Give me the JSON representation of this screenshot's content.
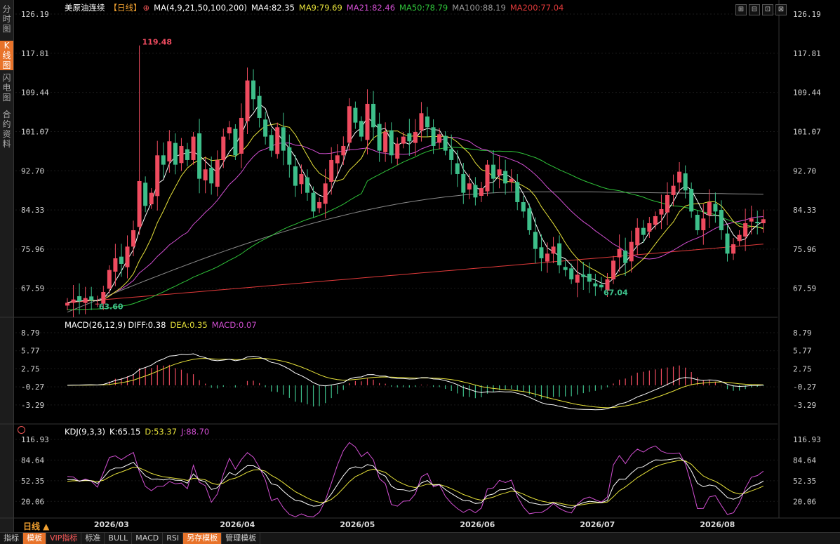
{
  "sidebar": {
    "tabs": [
      {
        "label": "分时图",
        "active": false
      },
      {
        "label": "K线图",
        "active": true
      },
      {
        "label": "闪电图",
        "active": false
      },
      {
        "label": "合约资料",
        "active": false
      }
    ]
  },
  "header": {
    "instrument": "美原油连续",
    "period_tag": "【日线】",
    "ma_params": "MA(4,9,21,50,100,200)",
    "ma4": "MA4:82.35",
    "ma9": "MA9:79.69",
    "ma21": "MA21:82.46",
    "ma50": "MA50:78.79",
    "ma100": "MA100:88.19",
    "ma200": "MA200:77.04"
  },
  "window_buttons": [
    "⊞",
    "⊟",
    "⊡",
    "⊠"
  ],
  "colors": {
    "up": "#ef4b5f",
    "down": "#3dbf8a",
    "ma4": "#ffffff",
    "ma9": "#e7e23a",
    "ma21": "#d24fd2",
    "ma50": "#2fc43a",
    "ma100": "#8a8a8a",
    "ma200": "#e23a3a",
    "macd_diff": "#ffffff",
    "macd_dea": "#e7e23a",
    "kdj_k": "#ffffff",
    "kdj_d": "#e7e23a",
    "kdj_j": "#d24fd2",
    "accent": "#e8732a"
  },
  "price_panel": {
    "ticks": [
      "126.19",
      "117.81",
      "109.44",
      "101.07",
      "92.70",
      "84.33",
      "75.96",
      "67.59"
    ],
    "high_label": "119.48",
    "low_label_1": "63.60",
    "low_label_2": "67.04"
  },
  "macd_panel": {
    "title": "MACD(26,12,9)",
    "diff": "DIFF:0.38",
    "dea": "DEA:0.35",
    "macd": "MACD:0.07",
    "ticks": [
      "8.79",
      "5.77",
      "2.75",
      "-0.27",
      "-3.29"
    ]
  },
  "kdj_panel": {
    "title": "KDJ(9,3,3)",
    "k": "K:65.15",
    "d": "D:53.37",
    "j": "J:88.70",
    "ticks": [
      "116.93",
      "84.64",
      "52.35",
      "20.06"
    ]
  },
  "dates": [
    "2026/03",
    "2026/04",
    "2026/05",
    "2026/06",
    "2026/07",
    "2026/08"
  ],
  "period_label": "日线 ▲",
  "bottom_tabs": [
    {
      "label": "指标",
      "style": "normal"
    },
    {
      "label": "模板",
      "style": "orange"
    },
    {
      "label": "VIP指标",
      "style": "red"
    },
    {
      "label": "标准",
      "style": "normal"
    },
    {
      "label": "BULL",
      "style": "normal"
    },
    {
      "label": "MACD",
      "style": "normal"
    },
    {
      "label": "RSI",
      "style": "normal"
    },
    {
      "label": "另存模板",
      "style": "orange"
    },
    {
      "label": "管理模板",
      "style": "normal"
    }
  ],
  "chart_data": {
    "type": "candlestick",
    "closes": [
      64.5,
      65.2,
      64.8,
      65.5,
      65.0,
      64.3,
      66.8,
      71.5,
      74.0,
      72.8,
      76.5,
      80.0,
      90.5,
      85.2,
      88.0,
      96.0,
      94.0,
      99.0,
      94.0,
      98.0,
      95.0,
      100.0,
      91.0,
      93.0,
      90.0,
      95.0,
      100.0,
      102.0,
      96.0,
      104.0,
      112.0,
      108.0,
      104.0,
      100.0,
      97.0,
      102.0,
      97.0,
      94.0,
      89.5,
      92.0,
      88.0,
      84.0,
      86.0,
      90.0,
      95.0,
      96.0,
      98.0,
      106.5,
      103.0,
      100.0,
      107.0,
      102.0,
      97.0,
      101.0,
      96.0,
      98.5,
      100.0,
      99.0,
      101.0,
      105.0,
      102.0,
      98.0,
      100.5,
      97.0,
      95.0,
      92.0,
      88.0,
      90.0,
      87.0,
      89.0,
      94.0,
      91.0,
      93.0,
      90.0,
      91.0,
      86.0,
      84.0,
      80.0,
      76.0,
      74.0,
      75.0,
      76.5,
      72.5,
      71.5,
      69.5,
      70.5,
      70.0,
      69.0,
      68.0,
      67.8,
      69.5,
      73.5,
      76.0,
      73.0,
      77.5,
      80.5,
      79.0,
      81.5,
      83.0,
      84.5,
      87.5,
      89.5,
      92.5,
      88.5,
      84.0,
      80.0,
      82.5,
      86.0,
      84.0,
      80.0,
      75.0,
      77.0,
      79.0,
      81.5,
      82.5,
      81.5,
      82.35
    ],
    "ma_last": {
      "MA4": 82.35,
      "MA9": 79.69,
      "MA21": 82.46,
      "MA50": 78.79,
      "MA100": 88.19,
      "MA200": 77.04
    },
    "macd_last": {
      "DIFF": 0.38,
      "DEA": 0.35,
      "MACD": 0.07
    },
    "kdj_last": {
      "K": 65.15,
      "D": 53.37,
      "J": 88.7
    },
    "price_range": [
      62.0,
      126.19
    ],
    "extremes": {
      "high": 119.48,
      "low1": 63.6,
      "low2": 67.04
    }
  }
}
